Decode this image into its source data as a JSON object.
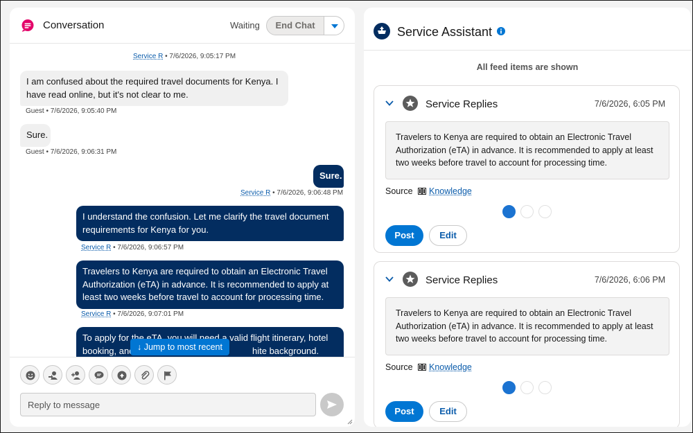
{
  "conversation": {
    "title": "Conversation",
    "status": "Waiting",
    "end_chat_label": "End Chat",
    "messages": [
      {
        "meta_sender": "Service R",
        "meta_time": "• 7/6/2026, 9:05:17 PM"
      },
      {
        "text": "I am confused about the required travel documents for Kenya. I have read online, but it's not clear to me.",
        "meta_sender": "Guest",
        "meta_time": "• 7/6/2026, 9:05:40 PM"
      },
      {
        "text": "Sure.",
        "meta_sender": "Guest",
        "meta_time": "• 7/6/2026, 9:06:31 PM"
      },
      {
        "text": "Sure.",
        "meta_sender": "Service R",
        "meta_time": "• 7/6/2026, 9:06:48 PM"
      },
      {
        "text": "I understand the confusion. Let me clarify the travel document requirements for Kenya for you.",
        "meta_sender": "Service R",
        "meta_time": "• 7/6/2026, 9:06:57 PM"
      },
      {
        "text": "Travelers to Kenya are required to obtain an Electronic Travel Authorization (eTA) in advance. It is recommended to apply at least two weeks before travel to account for processing time.",
        "meta_sender": "Service R",
        "meta_time": "• 7/6/2026, 9:07:01 PM"
      },
      {
        "text_a": "To apply for the eTA, you will need a valid flight itinerary, hotel",
        "text_b": "booking, and",
        "text_c": "hite background."
      }
    ],
    "jump_label": "Jump to most recent",
    "reply_placeholder": "Reply to message",
    "tools": [
      "smile-icon",
      "transfer-icon",
      "add-user-icon",
      "quick-text-icon",
      "knowledge-icon",
      "attach-icon",
      "flag-icon"
    ]
  },
  "assistant": {
    "title": "Service Assistant",
    "feed_note": "All feed items are shown",
    "cards": [
      {
        "title": "Service Replies",
        "time": "7/6/2026, 6:05 PM",
        "reply": "Travelers to Kenya are required to obtain an Electronic Travel Authorization (eTA) in advance. It is recommended to apply at least two weeks before travel to account for processing time.",
        "source_label": "Source",
        "source_link": "Knowledge",
        "post_label": "Post",
        "edit_label": "Edit"
      },
      {
        "title": "Service Replies",
        "time": "7/6/2026, 6:06 PM",
        "reply": "Travelers to Kenya are required to obtain an Electronic Travel Authorization (eTA) in advance. It is recommended to apply at least two weeks before travel to account for processing time.",
        "source_label": "Source",
        "source_link": "Knowledge",
        "post_label": "Post",
        "edit_label": "Edit"
      }
    ]
  },
  "colors": {
    "brand_blue": "#0176d3",
    "agent_bubble": "#032d60",
    "conversation_icon": "#e3066a"
  }
}
